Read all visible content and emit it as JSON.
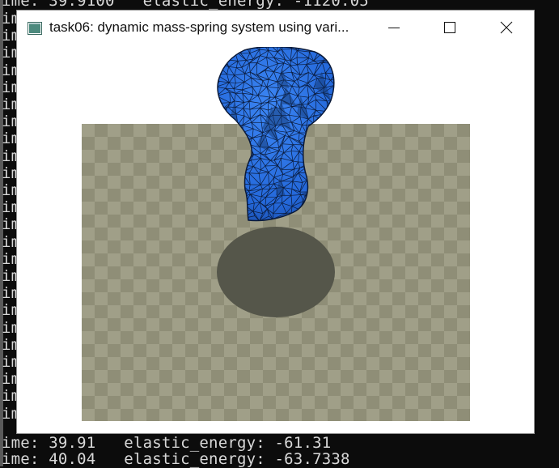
{
  "console": {
    "lines": [
      "ime: 39.91   elastic_energy: -61.31",
      "ime: 40.04   elastic_energy: -63.7338"
    ],
    "fragment": "im",
    "top_fragment": "ime: 39.9100   elastic_energy: -1120.05"
  },
  "window": {
    "title": "task06: dynamic mass-spring system using vari...",
    "icon": "app-window-icon",
    "controls": [
      "minimize-icon",
      "maximize-icon",
      "close-icon"
    ]
  },
  "scene": {
    "floor_color_a": "#8f8e77",
    "floor_color_b": "#a09f88",
    "shadow_color": "#55564a",
    "mesh_color": "#2d72e8",
    "mesh_edge_color": "#0a1a3a"
  }
}
